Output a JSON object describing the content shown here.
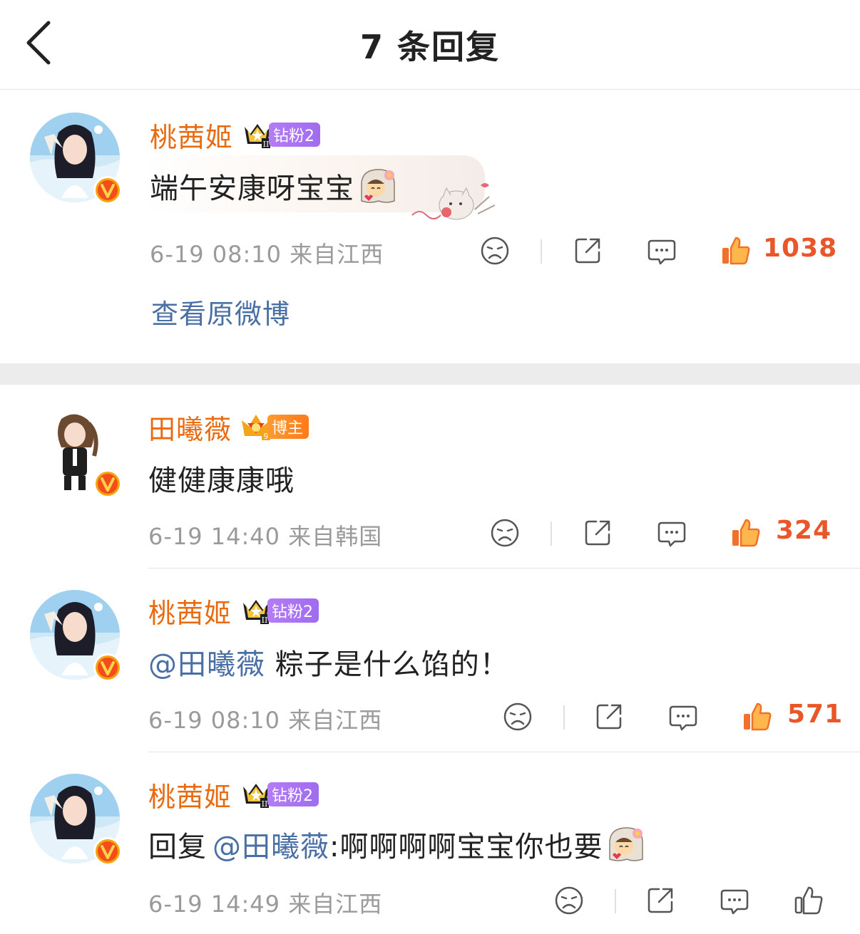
{
  "header": {
    "title": "7 条回复"
  },
  "root_comment": {
    "name": "桃茜姬",
    "fan_badge": "钻粉2",
    "text": "端午安康呀宝宝",
    "meta": "6-19 08:10  来自江西",
    "likes": "1038",
    "view_original": "查看原微博"
  },
  "replies": [
    {
      "name": "田曦薇",
      "fan_badge": "博主",
      "text": "健健康康哦",
      "meta": "6-19 14:40  来自韩国",
      "likes": "324"
    },
    {
      "name": "桃茜姬",
      "fan_badge": "钻粉2",
      "mention": "@田曦薇",
      "text": " 粽子是什么馅的！",
      "meta": "6-19 08:10  来自江西",
      "likes": "571"
    },
    {
      "name": "桃茜姬",
      "fan_badge": "钻粉2",
      "prefix": "回复",
      "mention": "@田曦薇",
      "text": ":啊啊啊啊宝宝你也要",
      "meta": "6-19 14:49  来自江西",
      "likes": ""
    }
  ],
  "colors": {
    "name": "#e86b11",
    "mention": "#4a6fa5",
    "like_active": "#e8562a",
    "meta": "#9a9a9a"
  },
  "icons": [
    "back-arrow-icon",
    "dislike-face-icon",
    "share-icon",
    "comment-icon",
    "thumbs-up-icon",
    "verified-v-icon",
    "crown-icon"
  ]
}
